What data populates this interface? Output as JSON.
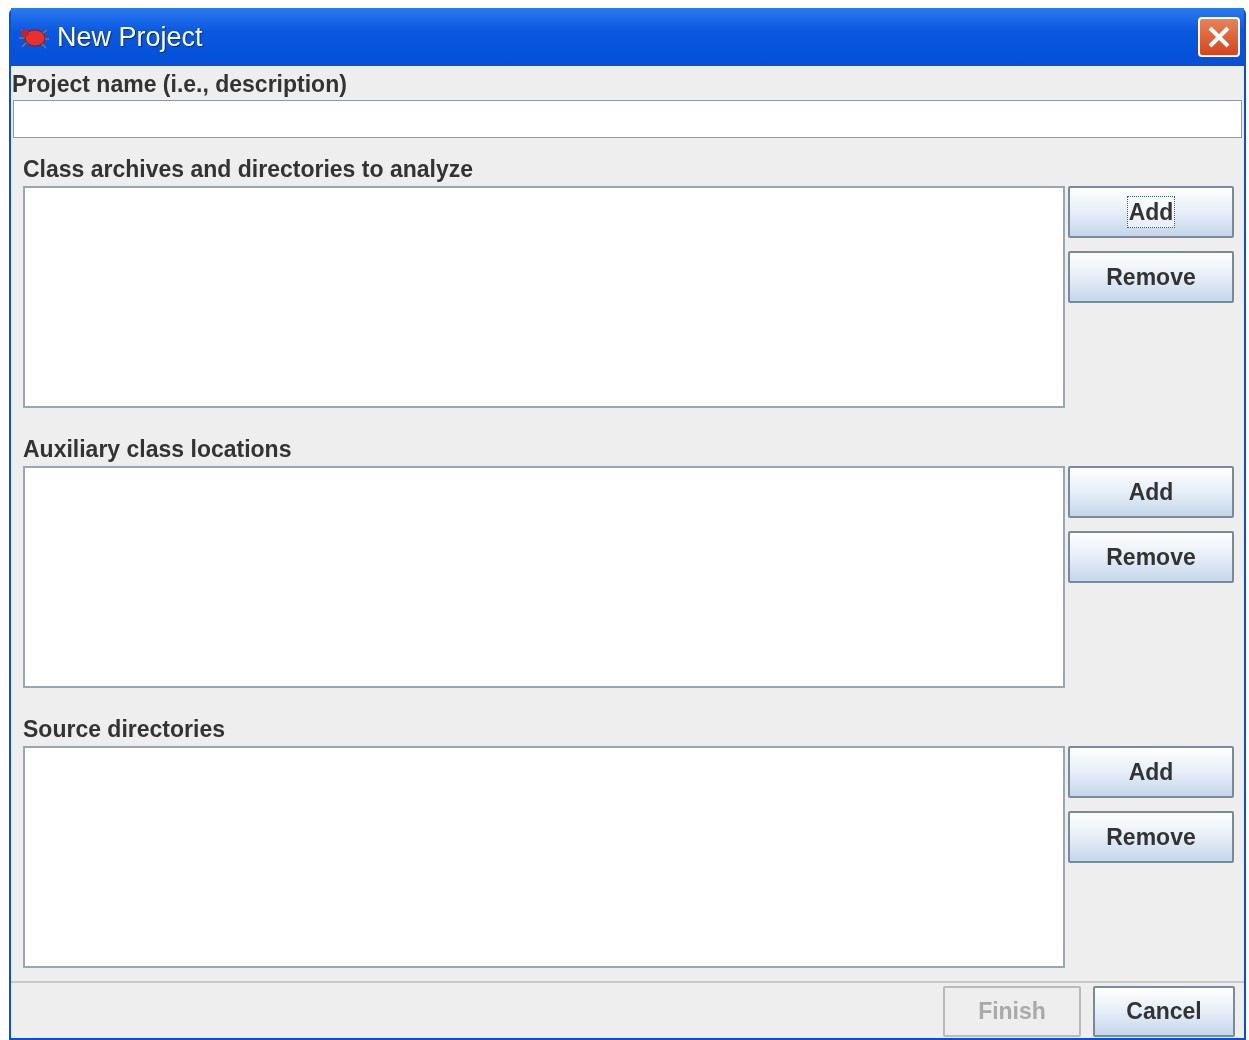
{
  "window": {
    "title": "New Project"
  },
  "project_name": {
    "label": "Project name (i.e., description)"
  },
  "sections": [
    {
      "label": "Class archives and directories to analyze",
      "buttons": [
        {
          "label": "Add",
          "focused": true
        },
        {
          "label": "Remove",
          "focused": false
        }
      ]
    },
    {
      "label": "Auxiliary class locations",
      "buttons": [
        {
          "label": "Add",
          "focused": false
        },
        {
          "label": "Remove",
          "focused": false
        }
      ]
    },
    {
      "label": "Source directories",
      "buttons": [
        {
          "label": "Add",
          "focused": false
        },
        {
          "label": "Remove",
          "focused": false
        }
      ]
    }
  ],
  "footer_buttons": [
    {
      "label": "Finish",
      "disabled": true
    },
    {
      "label": "Cancel",
      "disabled": false
    }
  ]
}
